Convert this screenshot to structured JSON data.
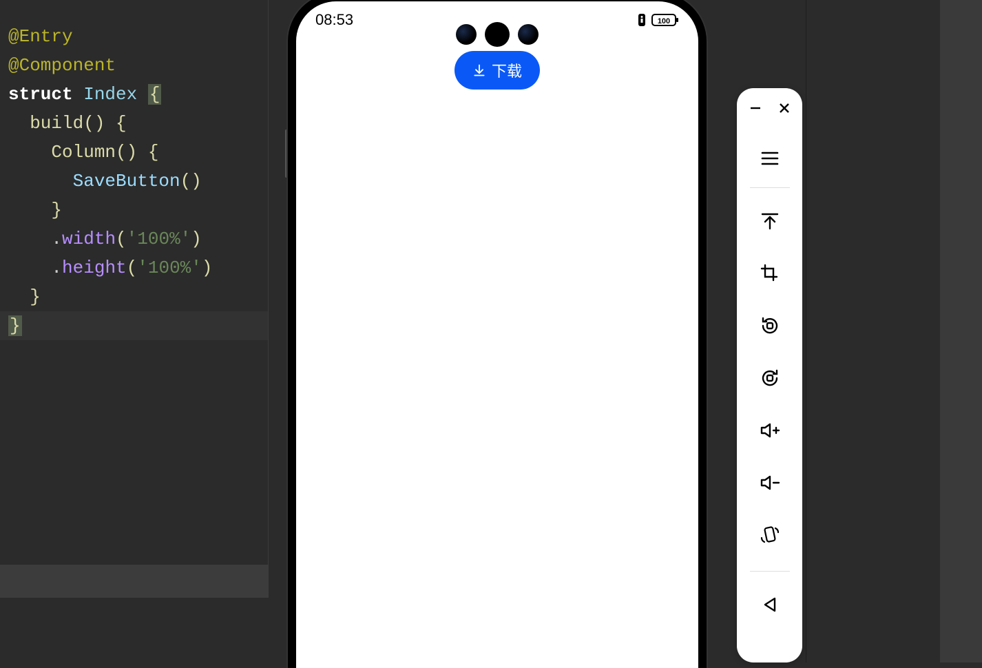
{
  "code": {
    "line1": "@Entry",
    "line2": "@Component",
    "struct_kw": "struct",
    "class_name": " Index ",
    "build_name": "  build",
    "column_name": "    Column",
    "savebutton_name": "      SaveButton",
    "close_inner": "    }",
    "width_method": "width",
    "height_method": "height",
    "arg_100": "'100%'",
    "close_build": "  }",
    "close_struct": "}"
  },
  "phone": {
    "time": "08:53",
    "battery": "100",
    "download_label": "下载"
  },
  "panel": {
    "minimize": "−",
    "close": "×"
  }
}
